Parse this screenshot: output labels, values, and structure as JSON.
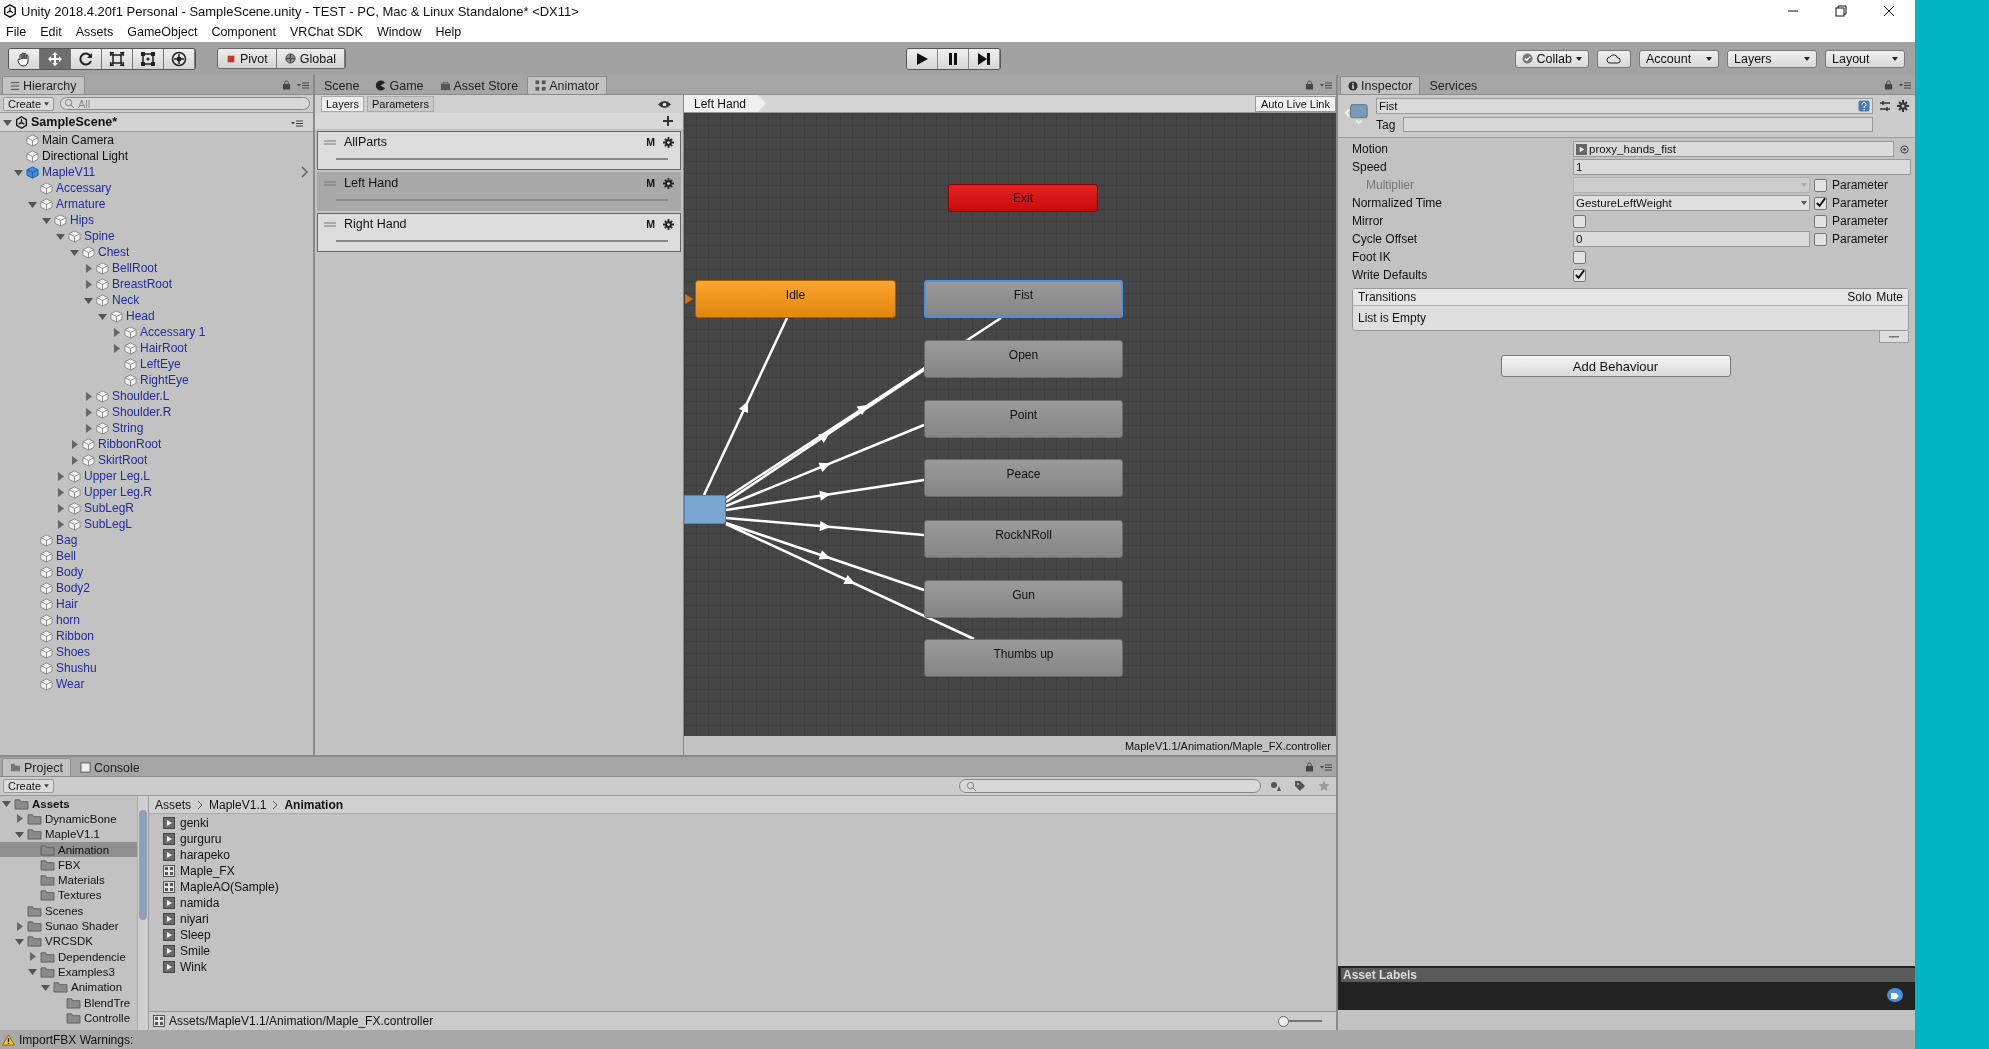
{
  "window": {
    "title": "Unity 2018.4.20f1 Personal - SampleScene.unity - TEST - PC, Mac & Linux Standalone* <DX11>"
  },
  "menu": [
    "File",
    "Edit",
    "Assets",
    "GameObject",
    "Component",
    "VRChat SDK",
    "Window",
    "Help"
  ],
  "toolbar": {
    "tools": [
      {
        "kind": "hand",
        "selected": false
      },
      {
        "kind": "move",
        "selected": true
      },
      {
        "kind": "rotate",
        "selected": false
      },
      {
        "kind": "scale",
        "selected": false
      },
      {
        "kind": "rect",
        "selected": false
      },
      {
        "kind": "transform",
        "selected": false
      }
    ],
    "pivot": "Pivot",
    "global": "Global",
    "playback": [
      {
        "kind": "play"
      },
      {
        "kind": "pause"
      },
      {
        "kind": "step"
      }
    ],
    "collab": "Collab",
    "account": "Account",
    "layers": "Layers",
    "layout": "Layout"
  },
  "hierarchy": {
    "tab": "Hierarchy",
    "create": "Create",
    "placeholder": "All",
    "scene": {
      "name": "SampleScene*",
      "expanded": true
    },
    "items": [
      {
        "name": "Main Camera",
        "kind": "object"
      },
      {
        "name": "Directional Light",
        "kind": "object"
      },
      {
        "name": "MapleV11",
        "kind": "prefab_root",
        "expanded": true,
        "children": [
          {
            "name": "Accessary",
            "kind": "prefab"
          },
          {
            "name": "Armature",
            "kind": "prefab",
            "expanded": true,
            "children": [
              {
                "name": "Hips",
                "kind": "prefab",
                "expanded": true,
                "children": [
                  {
                    "name": "Spine",
                    "kind": "prefab",
                    "expanded": true,
                    "children": [
                      {
                        "name": "Chest",
                        "kind": "prefab",
                        "expanded": true,
                        "children": [
                          {
                            "name": "BellRoot",
                            "kind": "prefab",
                            "expanded": false
                          },
                          {
                            "name": "BreastRoot",
                            "kind": "prefab",
                            "expanded": false
                          },
                          {
                            "name": "Neck",
                            "kind": "prefab",
                            "expanded": true,
                            "children": [
                              {
                                "name": "Head",
                                "kind": "prefab",
                                "expanded": true,
                                "children": [
                                  {
                                    "name": "Accessary 1",
                                    "kind": "prefab",
                                    "expanded": false
                                  },
                                  {
                                    "name": "HairRoot",
                                    "kind": "prefab",
                                    "expanded": false
                                  },
                                  {
                                    "name": "LeftEye",
                                    "kind": "prefab"
                                  },
                                  {
                                    "name": "RightEye",
                                    "kind": "prefab"
                                  }
                                ]
                              }
                            ]
                          },
                          {
                            "name": "Shoulder.L",
                            "kind": "prefab",
                            "expanded": false
                          },
                          {
                            "name": "Shoulder.R",
                            "kind": "prefab",
                            "expanded": false
                          },
                          {
                            "name": "String",
                            "kind": "prefab",
                            "expanded": false
                          }
                        ]
                      },
                      {
                        "name": "RibbonRoot",
                        "kind": "prefab",
                        "expanded": false
                      },
                      {
                        "name": "SkirtRoot",
                        "kind": "prefab",
                        "expanded": false
                      }
                    ]
                  },
                  {
                    "name": "Upper Leg.L",
                    "kind": "prefab",
                    "expanded": false
                  },
                  {
                    "name": "Upper Leg.R",
                    "kind": "prefab",
                    "expanded": false
                  },
                  {
                    "name": "SubLegR",
                    "kind": "prefab",
                    "expanded": false
                  },
                  {
                    "name": "SubLegL",
                    "kind": "prefab",
                    "expanded": false
                  }
                ]
              }
            ]
          },
          {
            "name": "Bag",
            "kind": "prefab"
          },
          {
            "name": "Bell",
            "kind": "prefab"
          },
          {
            "name": "Body",
            "kind": "prefab"
          },
          {
            "name": "Body2",
            "kind": "prefab"
          },
          {
            "name": "Hair",
            "kind": "prefab"
          },
          {
            "name": "horn",
            "kind": "prefab"
          },
          {
            "name": "Ribbon",
            "kind": "prefab"
          },
          {
            "name": "Shoes",
            "kind": "prefab"
          },
          {
            "name": "Shushu",
            "kind": "prefab"
          },
          {
            "name": "Wear",
            "kind": "prefab"
          }
        ]
      }
    ]
  },
  "center_tabs": [
    {
      "label": "Scene",
      "kind": "scene",
      "selected": false
    },
    {
      "label": "Game",
      "kind": "game",
      "selected": false
    },
    {
      "label": "Asset Store",
      "kind": "store",
      "selected": false
    },
    {
      "label": "Animator",
      "kind": "animator",
      "selected": true
    }
  ],
  "animator": {
    "side_tabs": [
      {
        "label": "Layers",
        "selected": true
      },
      {
        "label": "Parameters",
        "selected": false
      }
    ],
    "layers": [
      {
        "name": "AllParts",
        "mask": "M",
        "selected": false
      },
      {
        "name": "Left Hand",
        "mask": "M",
        "selected": true
      },
      {
        "name": "Right Hand",
        "mask": "M",
        "selected": false
      }
    ],
    "breadcrumb": "Left Hand",
    "auto_live_link": "Auto Live Link",
    "states": [
      {
        "name": "Exit",
        "kind": "exit",
        "selected": false
      },
      {
        "name": "Idle",
        "kind": "default",
        "selected": false
      },
      {
        "name": "Fist",
        "kind": "state",
        "selected": true
      },
      {
        "name": "Open",
        "kind": "state",
        "selected": false
      },
      {
        "name": "Point",
        "kind": "state",
        "selected": false
      },
      {
        "name": "Peace",
        "kind": "state",
        "selected": false
      },
      {
        "name": "RockNRoll",
        "kind": "state",
        "selected": false
      },
      {
        "name": "Gun",
        "kind": "state",
        "selected": false
      },
      {
        "name": "Thumbs up",
        "kind": "state",
        "selected": false
      },
      {
        "kind": "entry",
        "selected": false
      }
    ],
    "path": "MapleV1.1/Animation/Maple_FX.controller"
  },
  "inspector": {
    "tabs": [
      {
        "label": "Inspector",
        "selected": true
      },
      {
        "label": "Services",
        "selected": false
      }
    ],
    "name": "Fist",
    "tag_label": "Tag",
    "rows": [
      {
        "label": "Motion",
        "kind": "object",
        "value": "proxy_hands_fist",
        "disabled": false
      },
      {
        "label": "Speed",
        "kind": "text",
        "value": "1",
        "disabled": false
      },
      {
        "label": "Multiplier",
        "kind": "dropdown",
        "disabled": true,
        "parameter": {
          "label": "Parameter",
          "checked": false
        }
      },
      {
        "label": "Normalized Time",
        "kind": "dropdown",
        "value": "GestureLeftWeight",
        "disabled": false,
        "parameter": {
          "label": "Parameter",
          "checked": true
        }
      },
      {
        "label": "Mirror",
        "kind": "checkbox",
        "checked": false,
        "disabled": false,
        "parameter": {
          "label": "Parameter",
          "checked": false
        }
      },
      {
        "label": "Cycle Offset",
        "kind": "text",
        "value": "0",
        "disabled": false,
        "parameter": {
          "label": "Parameter",
          "checked": false
        }
      },
      {
        "label": "Foot IK",
        "kind": "checkbox",
        "checked": false,
        "disabled": false
      },
      {
        "label": "Write Defaults",
        "kind": "checkbox",
        "checked": true,
        "disabled": false
      }
    ],
    "transitions": {
      "title": "Transitions",
      "solo": "Solo",
      "mute": "Mute",
      "empty": "List is Empty"
    },
    "add_button": "Add Behaviour",
    "asset_labels": "Asset Labels"
  },
  "project": {
    "tabs": [
      {
        "label": "Project",
        "kind": "project",
        "selected": true
      },
      {
        "label": "Console",
        "kind": "console",
        "selected": false
      }
    ],
    "create": "Create",
    "tree": [
      {
        "name": "Assets",
        "expanded": true,
        "selected": false,
        "children": [
          {
            "name": "DynamicBone",
            "expanded": false,
            "selected": false
          },
          {
            "name": "MapleV1.1",
            "expanded": true,
            "selected": false,
            "children": [
              {
                "name": "Animation",
                "selected": true
              },
              {
                "name": "FBX",
                "selected": false
              },
              {
                "name": "Materials",
                "selected": false
              },
              {
                "name": "Textures",
                "selected": false
              }
            ]
          },
          {
            "name": "Scenes",
            "selected": false
          },
          {
            "name": "Sunao Shader",
            "expanded": false,
            "selected": false
          },
          {
            "name": "VRCSDK",
            "expanded": true,
            "selected": false,
            "children": [
              {
                "name": "Dependencie",
                "expanded": false,
                "selected": false
              },
              {
                "name": "Examples3",
                "expanded": true,
                "selected": false,
                "children": [
                  {
                    "name": "Animation",
                    "expanded": true,
                    "selected": false,
                    "children": [
                      {
                        "name": "BlendTre",
                        "selected": false
                      },
                      {
                        "name": "Controlle",
                        "selected": false
                      }
                    ]
                  }
                ]
              }
            ]
          }
        ]
      }
    ],
    "breadcrumb": [
      "Assets",
      "MapleV1.1",
      "Animation"
    ],
    "assets": [
      {
        "name": "genki",
        "kind": "clip"
      },
      {
        "name": "gurguru",
        "kind": "clip"
      },
      {
        "name": "harapeko",
        "kind": "clip"
      },
      {
        "name": "Maple_FX",
        "kind": "controller"
      },
      {
        "name": "MapleAO(Sample)",
        "kind": "controller"
      },
      {
        "name": "namida",
        "kind": "clip"
      },
      {
        "name": "niyari",
        "kind": "clip"
      },
      {
        "name": "Sleep",
        "kind": "clip"
      },
      {
        "name": "Smile",
        "kind": "clip"
      },
      {
        "name": "Wink",
        "kind": "clip"
      }
    ],
    "footer_path": "Assets/MapleV1.1/Animation/Maple_FX.controller",
    "zoom": {
      "level": 0
    }
  },
  "status": "ImportFBX Warnings:"
}
